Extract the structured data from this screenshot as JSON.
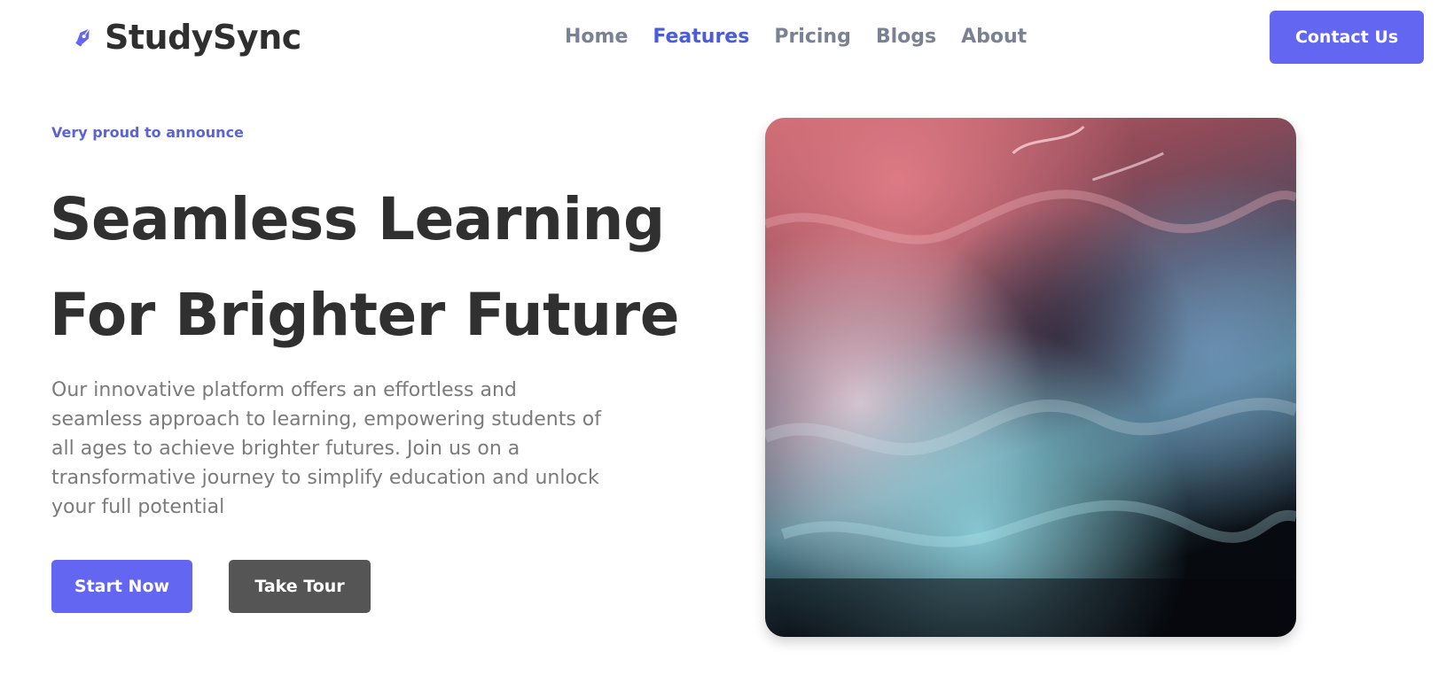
{
  "brand": {
    "name": "StudySync",
    "icon": "pen-nib-icon",
    "icon_color": "#6366f1"
  },
  "nav": {
    "items": [
      {
        "label": "Home",
        "active": false
      },
      {
        "label": "Features",
        "active": true
      },
      {
        "label": "Pricing",
        "active": false
      },
      {
        "label": "Blogs",
        "active": false
      },
      {
        "label": "About",
        "active": false
      }
    ]
  },
  "header": {
    "contact_label": "Contact Us"
  },
  "hero": {
    "eyebrow": "Very proud to announce",
    "title_line1": "Seamless Learning",
    "title_line2": "For Brighter Future",
    "description": "Our innovative platform offers an effortless and seamless approach to learning, empowering students of all ages to achieve brighter futures. Join us on a transformative journey to simplify education and unlock your full potential",
    "primary_cta": "Start Now",
    "secondary_cta": "Take Tour"
  },
  "colors": {
    "accent": "#6366f1",
    "nav_active": "#4a5bdc",
    "nav_default": "#7a8193",
    "heading": "#303030",
    "body_text": "#7b7b7b",
    "secondary_button": "#555555"
  }
}
